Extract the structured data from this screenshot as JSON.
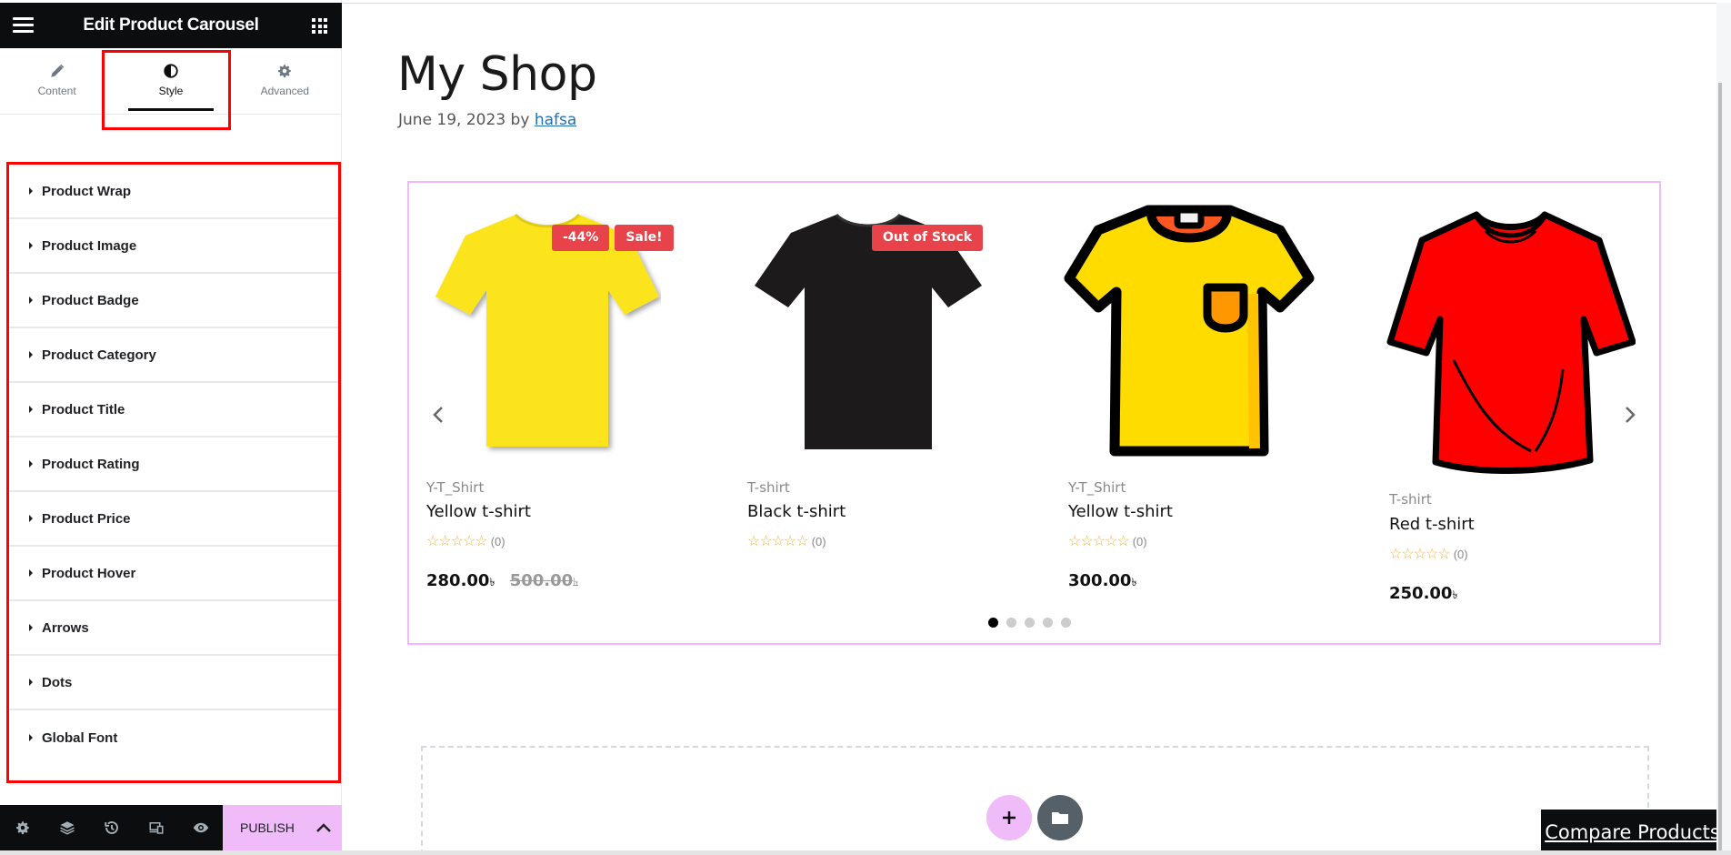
{
  "panel": {
    "title": "Edit Product Carousel",
    "tabs": [
      {
        "label": "Content",
        "icon": "pencil-icon",
        "active": false
      },
      {
        "label": "Style",
        "icon": "half-circle-icon",
        "active": true
      },
      {
        "label": "Advanced",
        "icon": "gear-icon",
        "active": false
      }
    ],
    "sections": [
      "Product Wrap",
      "Product Image",
      "Product Badge",
      "Product Category",
      "Product Title",
      "Product Rating",
      "Product Price",
      "Product Hover",
      "Arrows",
      "Dots",
      "Global Font"
    ],
    "footer": {
      "icons": [
        "settings-icon",
        "layers-icon",
        "history-icon",
        "responsive-icon",
        "preview-eye-icon"
      ],
      "publish_label": "PUBLISH"
    },
    "highlight_color": "#ff0000",
    "accent_color": "#f0bbf9"
  },
  "page": {
    "title": "My Shop",
    "date": "June 19, 2023",
    "by": "by",
    "author": "hafsa"
  },
  "carousel": {
    "products": [
      {
        "category": "Y-T_Shirt",
        "title": "Yellow t-shirt",
        "rating": "(0)",
        "stars": "☆☆☆☆☆",
        "price": "280.00",
        "old_price": "500.00",
        "currency": "৳",
        "badges": [
          "-44%",
          "Sale!"
        ],
        "image": "yellow-tshirt-photo"
      },
      {
        "category": "T-shirt",
        "title": "Black t-shirt",
        "rating": "(0)",
        "stars": "☆☆☆☆☆",
        "price": "",
        "old_price": "",
        "currency": "৳",
        "badges": [
          "Out of Stock"
        ],
        "image": "black-tshirt-photo"
      },
      {
        "category": "Y-T_Shirt",
        "title": "Yellow t-shirt",
        "rating": "(0)",
        "stars": "☆☆☆☆☆",
        "price": "300.00",
        "old_price": "",
        "currency": "৳",
        "badges": [],
        "image": "yellow-tshirt-illustration"
      },
      {
        "category": "T-shirt",
        "title": "Red t-shirt",
        "rating": "(0)",
        "stars": "☆☆☆☆☆",
        "price": "250.00",
        "old_price": "",
        "currency": "৳",
        "badges": [],
        "image": "red-tshirt-illustration"
      }
    ],
    "dots_total": 5,
    "dots_active_index": 0,
    "badge_color": "#e8434a"
  },
  "compare_label": "Compare Products"
}
